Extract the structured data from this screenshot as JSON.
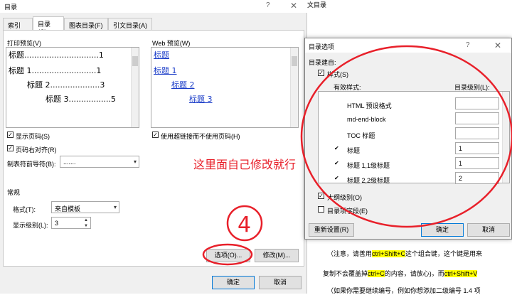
{
  "toc_dialog": {
    "title": "目录",
    "help": "?",
    "close": "✕",
    "tabs": [
      "索引(X)",
      "目录(C)",
      "图表目录(F)",
      "引文目录(A)"
    ],
    "print_preview_label": "打印预览(V)",
    "print_preview_lines": [
      "标题..............................1",
      "标题 1..........................1",
      "标题 2....................3",
      "标题 3.................5"
    ],
    "web_preview_label": "Web 预览(W)",
    "web_links": [
      "标题",
      "标题 1",
      "标题 2",
      "标题 3"
    ],
    "show_page_numbers": "显示页码(S)",
    "right_align_page_numbers": "页码右对齐(R)",
    "use_hyperlinks": "使用超链接而不使用页码(H)",
    "tab_leader_label": "制表符前导符(B):",
    "tab_leader_value": ".......",
    "general_label": "常规",
    "formats_label": "格式(T):",
    "formats_value": "来自模板",
    "show_levels_label": "显示级别(L):",
    "show_levels_value": "3",
    "options_button": "选项(O)...",
    "modify_button": "修改(M)...",
    "ok_button": "确定",
    "cancel_button": "取消"
  },
  "options_dialog": {
    "title": "目录选项",
    "help": "?",
    "close": "✕",
    "build_from_label": "目录建自:",
    "styles_label": "样式(S)",
    "available_styles_label": "有效样式:",
    "toc_level_label": "目录级别(L):",
    "rows": [
      {
        "name": "HTML 预设格式",
        "checked": false,
        "level": ""
      },
      {
        "name": "md-end-block",
        "checked": false,
        "level": ""
      },
      {
        "name": "TOC 标题",
        "checked": false,
        "level": ""
      },
      {
        "name": "标题",
        "checked": true,
        "level": "1"
      },
      {
        "name": "标题 1,1级标题",
        "checked": true,
        "level": "1"
      },
      {
        "name": "标题 2,2级标题",
        "checked": true,
        "level": "2"
      }
    ],
    "outline_levels_label": "大纲级别(O)",
    "table_entry_fields_label": "目录项字段(E)",
    "reset_button": "重新设置(R)",
    "ok_button": "确定",
    "cancel_button": "取消"
  },
  "document": {
    "header": "文目录",
    "line1_a": "（注意，请善用",
    "line1_key": "ctrl+Shift+C",
    "line1_b": "这个组合键，这个键是用来",
    "line2_a": "复制不会覆盖掉",
    "line2_key": "ctrl+C",
    "line2_b": "的内容，请放心)，而",
    "line2_key2": "ctrl+Shift+V",
    "line3": "（如果你需要继续编号，例如你想添加二级编号 1.4 项"
  },
  "annotations": {
    "note": "这里面自己修改就行",
    "number": "4"
  },
  "colors": {
    "annotation_red": "#e8202a",
    "link_blue": "#1a3cc8",
    "highlight_yellow": "#ffff00"
  }
}
